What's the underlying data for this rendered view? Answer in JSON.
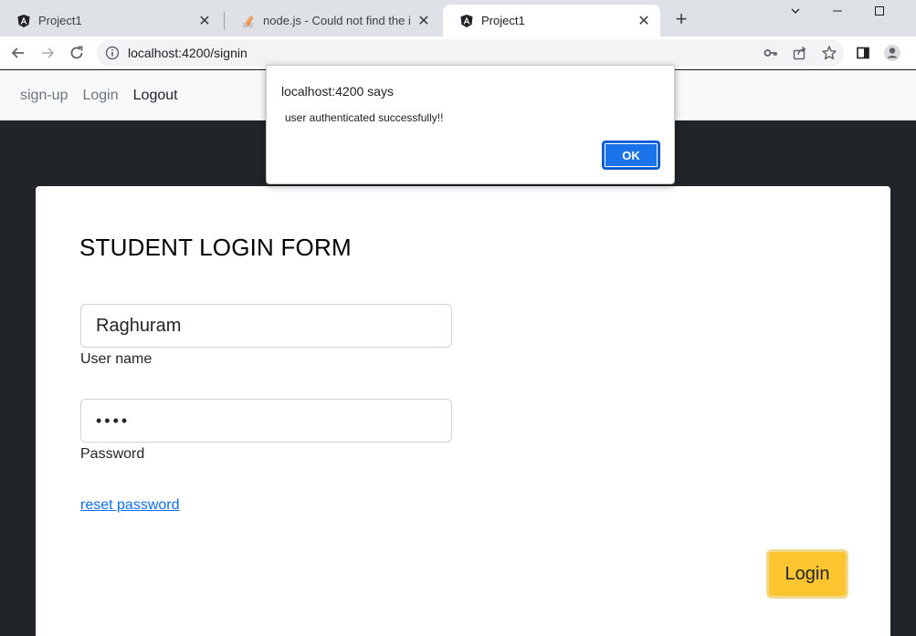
{
  "browser": {
    "tabs": [
      {
        "title": "Project1",
        "favicon": "angular-icon",
        "active": false
      },
      {
        "title": "node.js - Could not find the implementation",
        "favicon": "stackoverflow-icon",
        "active": false
      },
      {
        "title": "Project1",
        "favicon": "angular-icon",
        "active": true
      }
    ],
    "new_tab_label": "+",
    "url": "localhost:4200/signin"
  },
  "navbar": {
    "links": [
      {
        "label": "sign-up",
        "active": false
      },
      {
        "label": "Login",
        "active": false
      },
      {
        "label": "Logout",
        "active": true
      }
    ]
  },
  "form": {
    "title": "STUDENT LOGIN FORM",
    "username_value": "Raghuram",
    "username_label": "User name",
    "password_value": "1234",
    "password_label": "Password",
    "reset_link": "reset password",
    "login_button": "Login"
  },
  "dialog": {
    "title": "localhost:4200 says",
    "message": "user authenticated successfully!!",
    "ok_label": "OK"
  },
  "colors": {
    "page_bg": "#212529",
    "login_button": "#ffc531",
    "link": "#0d6efd",
    "dialog_ok": "#1a73e8"
  }
}
